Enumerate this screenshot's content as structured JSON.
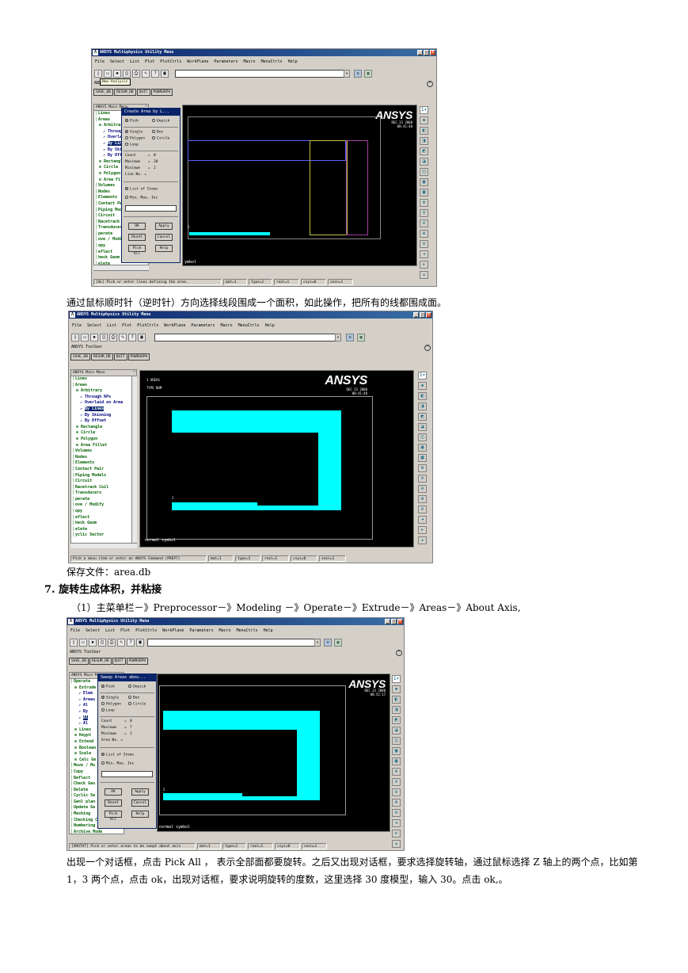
{
  "screenshot1": {
    "title": "ANSYS Multiphysics Utility Menu",
    "menu": [
      "File",
      "Select",
      "List",
      "Plot",
      "PlotCtrls",
      "WorkPlane",
      "Parameters",
      "Macro",
      "MenuCtrls",
      "Help"
    ],
    "tooltip": "New Analysis",
    "toolbar_partial": "ANS",
    "toolbar_buttons": [
      "SAVE_DB",
      "RESUM_DB",
      "QUIT",
      "POWRGRPH"
    ],
    "main_menu_header": "ANSYS Main Menu",
    "menu_items": [
      {
        "t": "Lines",
        "lv": 0
      },
      {
        "t": "Areas",
        "lv": 0
      },
      {
        "t": "Arbitrar",
        "lv": 1
      },
      {
        "t": "Through",
        "lv": 2
      },
      {
        "t": "Overlai",
        "lv": 2
      },
      {
        "t": "By Lin",
        "lv": 2,
        "sel": true
      },
      {
        "t": "By Ski",
        "lv": 2
      },
      {
        "t": "By Off",
        "lv": 2
      },
      {
        "t": "Rectangl",
        "lv": 1
      },
      {
        "t": "Circle",
        "lv": 1
      },
      {
        "t": "Polygon",
        "lv": 1
      },
      {
        "t": "Area Fil",
        "lv": 1
      },
      {
        "t": "Volumes",
        "lv": 0
      },
      {
        "t": "Nodes",
        "lv": 0
      },
      {
        "t": "Elements",
        "lv": 0
      },
      {
        "t": "Contact Pa",
        "lv": 0
      },
      {
        "t": "Piping Mod",
        "lv": 0
      },
      {
        "t": "Circuit",
        "lv": 0
      },
      {
        "t": "Racetrack",
        "lv": 0
      },
      {
        "t": "Transducer",
        "lv": 0
      },
      {
        "t": "perate",
        "lv": 0
      },
      {
        "t": "ove / Modify",
        "lv": 0
      },
      {
        "t": "opy",
        "lv": 0
      },
      {
        "t": "eflect",
        "lv": 0
      },
      {
        "t": "heck Geom",
        "lv": 0
      },
      {
        "t": "elete",
        "lv": 0
      },
      {
        "t": "yclic Sector",
        "lv": 0
      }
    ],
    "dialog": {
      "title": "Create Area by L...",
      "pick": "Pick",
      "unpick": "Unpick",
      "single": "Single",
      "box": "Box",
      "polygon": "Polygon",
      "circle": "Circle",
      "loop": "Loop",
      "count_label": "Count",
      "count": "0",
      "max_label": "Maximum",
      "max": "20",
      "min_label": "Minimum",
      "min": "2",
      "line_no": "Line No. =",
      "list_items": "List of Items",
      "min_max": "Min, Max, Inc",
      "ok": "OK",
      "apply": "Apply",
      "reset": "Reset",
      "cancel": "Cancel",
      "pick_all": "Pick All",
      "help": "Help"
    },
    "logo": "ANSYS",
    "date": "DEC 23 2008",
    "time": "08:41:48",
    "axis_label": "2",
    "symbol_text": "ymbol",
    "status": [
      "[AL] Pick or enter lines defining the area.",
      "mat=1",
      "type=1",
      "real=1",
      "csys=0",
      "secn=1"
    ]
  },
  "para1": "通过鼠标顺时针（逆时针）方向选择线段围成一个面积，如此操作，把所有的线都围成面。",
  "screenshot2": {
    "title": "ANSYS Multiphysics Utility Menu",
    "menu": [
      "File",
      "Select",
      "List",
      "Plot",
      "PlotCtrls",
      "WorkPlane",
      "Parameters",
      "Macro",
      "MenuCtrls",
      "Help"
    ],
    "toolbar_label": "ANSYS Toolbar",
    "toolbar_buttons": [
      "SAVE_DB",
      "RESUM_DB",
      "QUIT",
      "POWRGRPH"
    ],
    "main_menu_header": "ANSYS Main Menu",
    "menu_items": [
      {
        "t": "Lines",
        "lv": 0
      },
      {
        "t": "Areas",
        "lv": 0
      },
      {
        "t": "Arbitrary",
        "lv": 1
      },
      {
        "t": "Through KPs",
        "lv": 2
      },
      {
        "t": "Overlaid on Area",
        "lv": 2
      },
      {
        "t": "By Lines",
        "lv": 2,
        "sel": true
      },
      {
        "t": "By Skinning",
        "lv": 2
      },
      {
        "t": "By Offset",
        "lv": 2
      },
      {
        "t": "Rectangle",
        "lv": 1
      },
      {
        "t": "Circle",
        "lv": 1
      },
      {
        "t": "Polygon",
        "lv": 1
      },
      {
        "t": "Area Fillet",
        "lv": 1
      },
      {
        "t": "Volumes",
        "lv": 0
      },
      {
        "t": "Nodes",
        "lv": 0
      },
      {
        "t": "Elements",
        "lv": 0
      },
      {
        "t": "Contact Pair",
        "lv": 0
      },
      {
        "t": "Piping Models",
        "lv": 0
      },
      {
        "t": "Circuit",
        "lv": 0
      },
      {
        "t": "Racetrack Coil",
        "lv": 0
      },
      {
        "t": "Transducers",
        "lv": 0
      },
      {
        "t": "perate",
        "lv": 0
      },
      {
        "t": "ove / Modify",
        "lv": 0
      },
      {
        "t": "opy",
        "lv": 0
      },
      {
        "t": "eflect",
        "lv": 0
      },
      {
        "t": "heck Geom",
        "lv": 0
      },
      {
        "t": "elete",
        "lv": 0
      },
      {
        "t": "yclic Sector",
        "lv": 0
      }
    ],
    "logo": "ANSYS",
    "plot_label": "1 AREAS",
    "type_num": "TYPE NUM",
    "date": "DEC 23 2008",
    "time": "08:41:48",
    "axis_label": "2",
    "symbol_text": "normal symbol",
    "status": [
      "Pick a menu item or enter an ANSYS Command (PREP7)",
      "mat=1",
      "type=1",
      "real=1",
      "csys=0",
      "secn=1"
    ]
  },
  "save_file": "保存文件：area.db",
  "heading7": "7. 旋转生成体积，并粘接",
  "step1": "（1）主菜单栏－》Preprocessor－》Modeling －》Operate－》Extrude－》Areas－》About Axis,",
  "screenshot3": {
    "title": "ANSYS Multiphysics Utility Menu",
    "menu": [
      "File",
      "Select",
      "List",
      "Plot",
      "PlotCtrls",
      "WorkPlane",
      "Parameters",
      "Macro",
      "MenuCtrls",
      "Help"
    ],
    "toolbar_label": "ANSYS Toolbar",
    "toolbar_buttons": [
      "SAVE_DB",
      "RESUM_DB",
      "QUIT",
      "POWRGRPH"
    ],
    "main_menu_header": "ANSYS Main M",
    "menu_items": [
      {
        "t": "Operate",
        "lv": 0
      },
      {
        "t": "Extrude",
        "lv": 1
      },
      {
        "t": "Elem",
        "lv": 2
      },
      {
        "t": "Areas",
        "lv": 2
      },
      {
        "t": "Al",
        "lv": 2
      },
      {
        "t": "By",
        "lv": 2
      },
      {
        "t": "Al",
        "lv": 2,
        "sel": true
      },
      {
        "t": "Al",
        "lv": 2
      },
      {
        "t": "Lines",
        "lv": 1
      },
      {
        "t": "Keypt",
        "lv": 1
      },
      {
        "t": "Extend",
        "lv": 1
      },
      {
        "t": "Boolean",
        "lv": 1
      },
      {
        "t": "Scale",
        "lv": 1
      },
      {
        "t": "Calc Ge",
        "lv": 1
      },
      {
        "t": "Move / Mo",
        "lv": 0
      },
      {
        "t": "Copy",
        "lv": 0
      },
      {
        "t": "Reflect",
        "lv": 0
      },
      {
        "t": "Check Geo",
        "lv": 0
      },
      {
        "t": "Delete",
        "lv": 0
      },
      {
        "t": "Cyclic Se",
        "lv": 0
      },
      {
        "t": "Genl plan",
        "lv": 0
      },
      {
        "t": "Update Ge",
        "lv": 0
      },
      {
        "t": "Meshing",
        "lv": 0
      },
      {
        "t": "Checking Ct",
        "lv": 0
      },
      {
        "t": "Numbering C",
        "lv": 0
      },
      {
        "t": "Archive Mode",
        "lv": 0
      },
      {
        "t": "Coupling / Ceqn",
        "lv": 0
      }
    ],
    "dialog": {
      "title": "Sweep Areas abou...",
      "pick": "Pick",
      "unpick": "Unpick",
      "single": "Single",
      "box": "Box",
      "polygon": "Polygon",
      "circle": "Circle",
      "loop": "Loop",
      "count_label": "Count",
      "count": "0",
      "max_label": "Maximum",
      "max": "7",
      "min_label": "Minimum",
      "min": "1",
      "line_no": "Area No. =",
      "list_items": "List of Items",
      "min_max": "Min, Max, Inc",
      "ok": "OK",
      "apply": "Apply",
      "reset": "Reset",
      "cancel": "Cancel",
      "pick_all": "Pick All",
      "help": "Help"
    },
    "logo": "ANSYS",
    "date": "DEC 23 2008",
    "time": "08:52:17",
    "axis_label": "2",
    "symbol_text": "normal symbol",
    "status": [
      "[VROTAT] Pick or enter areas to be swept about axis",
      "mat=1",
      "type=1",
      "real=1",
      "csys=0",
      "secn=1"
    ]
  },
  "para2": "出现一个对话框，点击 Pick All ， 表示全部面都要旋转。之后又出现对话框，要求选择旋转轴，通过鼠标选择 Z 轴上的两个点，比如第 1，3 两个点，点击 ok，出现对话框，要求说明旋转的度数，这里选择 30 度模型，输入 30。点击 ok,。"
}
